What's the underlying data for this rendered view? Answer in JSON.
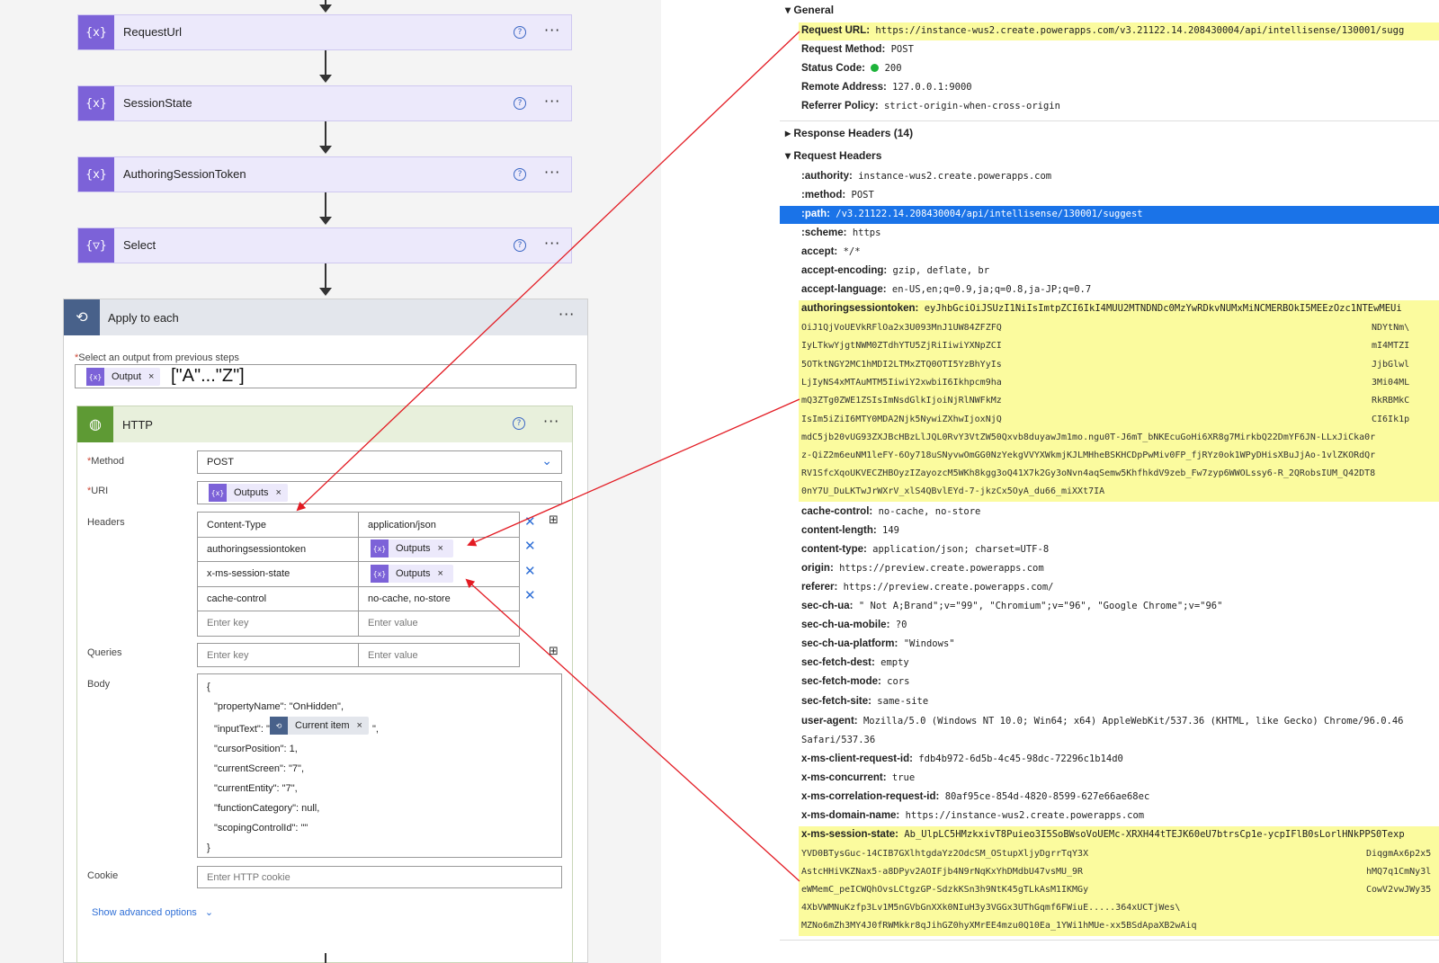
{
  "flow": {
    "steps": [
      {
        "title": "RequestUrl",
        "icon": "{x}"
      },
      {
        "title": "SessionState",
        "icon": "{x}"
      },
      {
        "title": "AuthoringSessionToken",
        "icon": "{x}"
      },
      {
        "title": "Select",
        "icon": "{▽}"
      }
    ],
    "apply": {
      "title": "Apply to each",
      "select_label": "Select an output from previous steps",
      "output_token": "Output",
      "output_annotation": "[\"A\"...\"Z\"]"
    },
    "http": {
      "title": "HTTP",
      "method_label": "Method",
      "method_value": "POST",
      "uri_label": "URI",
      "uri_token": "Outputs",
      "headers_label": "Headers",
      "headers": [
        {
          "key": "Content-Type",
          "value": "application/json",
          "token": false
        },
        {
          "key": "authoringsessiontoken",
          "value": "Outputs",
          "token": true
        },
        {
          "key": "x-ms-session-state",
          "value": "Outputs",
          "token": true
        },
        {
          "key": "cache-control",
          "value": "no-cache, no-store",
          "token": false
        }
      ],
      "key_placeholder": "Enter key",
      "value_placeholder": "Enter value",
      "queries_label": "Queries",
      "body_label": "Body",
      "body_lines": [
        "{",
        "\"propertyName\": \"OnHidden\",",
        "\"inputText\": \"",
        "\"cursorPosition\": 1,",
        "\"currentScreen\": \"7\",",
        "\"currentEntity\": \"7\",",
        "\"functionCategory\": null,",
        "\"scopingControlId\": \"\"",
        "}"
      ],
      "body_token": "Current item",
      "body_after_token": "\",",
      "cookie_label": "Cookie",
      "cookie_placeholder": "Enter HTTP cookie",
      "advanced": "Show advanced options"
    }
  },
  "devtools": {
    "general_title": "General",
    "general": [
      {
        "k": "Request URL:",
        "v": "https://instance-wus2.create.powerapps.com/v3.21122.14.208430004/api/intellisense/130001/sugg"
      },
      {
        "k": "Request Method:",
        "v": "POST"
      },
      {
        "k": "Status Code:",
        "v": "200"
      },
      {
        "k": "Remote Address:",
        "v": "127.0.0.1:9000"
      },
      {
        "k": "Referrer Policy:",
        "v": "strict-origin-when-cross-origin"
      }
    ],
    "response_headers_title": "Response Headers (14)",
    "request_headers_title": "Request Headers",
    "request_headers": [
      {
        "k": ":authority:",
        "v": "instance-wus2.create.powerapps.com"
      },
      {
        "k": ":method:",
        "v": "POST"
      },
      {
        "k": ":path:",
        "v": "/v3.21122.14.208430004/api/intellisense/130001/suggest"
      },
      {
        "k": ":scheme:",
        "v": "https"
      },
      {
        "k": "accept:",
        "v": "*/*"
      },
      {
        "k": "accept-encoding:",
        "v": "gzip, deflate, br"
      },
      {
        "k": "accept-language:",
        "v": "en-US,en;q=0.9,ja;q=0.8,ja-JP;q=0.7"
      },
      {
        "k": "authoringsessiontoken:",
        "v": "eyJhbGciOiJSUzI1NiIsImtpZCI6IkI4MUU2MTNDNDc0MzYwRDkvNUMxMiNCMERBOkI5MEEzOzc1NTEwMEUi"
      }
    ],
    "token_lines": [
      {
        "l": "OiJ1QjVoUEVkRFlOa2x3U093MnJ1UW84ZFZFQ",
        "r": "NDYtNm\\"
      },
      {
        "l": "IyLTkwYjgtNWM0ZTdhYTU5ZjRiIiwiYXNpZCI",
        "r": "mI4MTZI"
      },
      {
        "l": "5OTktNGY2MC1hMDI2LTMxZTQ0OTI5YzBhYyIs",
        "r": "JjbGlwl"
      },
      {
        "l": "LjIyNS4xMTAuMTM5IiwiY2xwbiI6Ikhpcm9ha",
        "r": "3Mi04ML"
      },
      {
        "l": "mQ3ZTg0ZWE1ZSIsImNsdGlkIjoiNjRlNWFkMz",
        "r": "RkRBMkC"
      },
      {
        "l": "IsIm5iZiI6MTY0MDA2Njk5NywiZXhwIjoxNjQ",
        "r": "CI6Ik1p"
      },
      {
        "l": "mdC5jb20vUG93ZXJBcHBzLlJQL0RvY3VtZW50Qxvb8duyawJm1mo.ngu0T-J6mT_bNKEcuGoHi6XR8g7MirkbQ22DmYF6JN-LLxJiCka0r",
        "r": ""
      },
      {
        "l": "z-QiZ2m6euNM1leFY-6Oy718uSNyvwOmGG0NzYekgVVYXWkmjKJLMHheBSKHCDpPwMiv0FP_fjRYz0ok1WPyDHisXBuJjAo-1vlZKORdQr",
        "r": ""
      },
      {
        "l": "RV1SfcXqoUKVECZHBOyzIZayozcM5WKh8kgg3oQ41X7k2Gy3oNvn4aqSemw5KhfhkdV9zeb_Fw7zyp6WWOLssy6-R_2QRobsIUM_Q42DT8",
        "r": ""
      },
      {
        "l": "0nY7U_DuLKTwJrWXrV_xlS4QBvlEYd-7-jkzCx5OyA_du66_miXXt7IA",
        "r": ""
      }
    ],
    "more_headers": [
      {
        "k": "cache-control:",
        "v": "no-cache, no-store"
      },
      {
        "k": "content-length:",
        "v": "149"
      },
      {
        "k": "content-type:",
        "v": "application/json; charset=UTF-8"
      },
      {
        "k": "origin:",
        "v": "https://preview.create.powerapps.com"
      },
      {
        "k": "referer:",
        "v": "https://preview.create.powerapps.com/"
      },
      {
        "k": "sec-ch-ua:",
        "v": "\" Not A;Brand\";v=\"99\", \"Chromium\";v=\"96\", \"Google Chrome\";v=\"96\""
      },
      {
        "k": "sec-ch-ua-mobile:",
        "v": "?0"
      },
      {
        "k": "sec-ch-ua-platform:",
        "v": "\"Windows\""
      },
      {
        "k": "sec-fetch-dest:",
        "v": "empty"
      },
      {
        "k": "sec-fetch-mode:",
        "v": "cors"
      },
      {
        "k": "sec-fetch-site:",
        "v": "same-site"
      },
      {
        "k": "user-agent:",
        "v": "Mozilla/5.0 (Windows NT 10.0; Win64; x64) AppleWebKit/537.36 (KHTML, like Gecko) Chrome/96.0.46"
      }
    ],
    "ua_cont": "Safari/537.36",
    "tail_headers": [
      {
        "k": "x-ms-client-request-id:",
        "v": "fdb4b972-6d5b-4c45-98dc-72296c1b14d0"
      },
      {
        "k": "x-ms-concurrent:",
        "v": "true"
      },
      {
        "k": "x-ms-correlation-request-id:",
        "v": "80af95ce-854d-4820-8599-627e66ae68ec"
      },
      {
        "k": "x-ms-domain-name:",
        "v": "https://instance-wus2.create.powerapps.com"
      },
      {
        "k": "x-ms-session-state:",
        "v": "Ab_UlpLC5HMzkxivT8Puieo3I5SoBWsoVoUEMc-XRXH44tTEJK60eU7btrsCp1e-ycpIFlB0sLorlHNkPPS0Texp"
      }
    ],
    "session_lines": [
      {
        "l": "YVD0BTysGuc-14CIB7GXlhtgdaYz2OdcSM_OStupXljyDgrrTqY3X",
        "r": "DiqgmAx6p2x5"
      },
      {
        "l": "AstcHHiVKZNax5-a8DPyv2AOIFjb4N9rNqKxYhDMdbU47vsMU_9R",
        "r": "hMQ7q1CmNy3l"
      },
      {
        "l": "eWMemC_peICWQhOvsLCtgzGP-SdzkKSn3h9NtK45gTLkAsM1IKMGy",
        "r": "CowV2vwJWy35"
      },
      {
        "l": "4XbVWMNuKzfp3Lv1M5nGVbGnXXk0NIuH3y3VGGx3UThGqmf6FWiuE.....364xUCTjWes\\",
        "r": ""
      },
      {
        "l": "MZNo6mZh3MY4J0fRWMkkr8qJihGZ0hyXMrEE4mzu0Q10Ea_1YWi1hMUe-xx5BSdApaXB2wAiq",
        "r": ""
      }
    ]
  }
}
